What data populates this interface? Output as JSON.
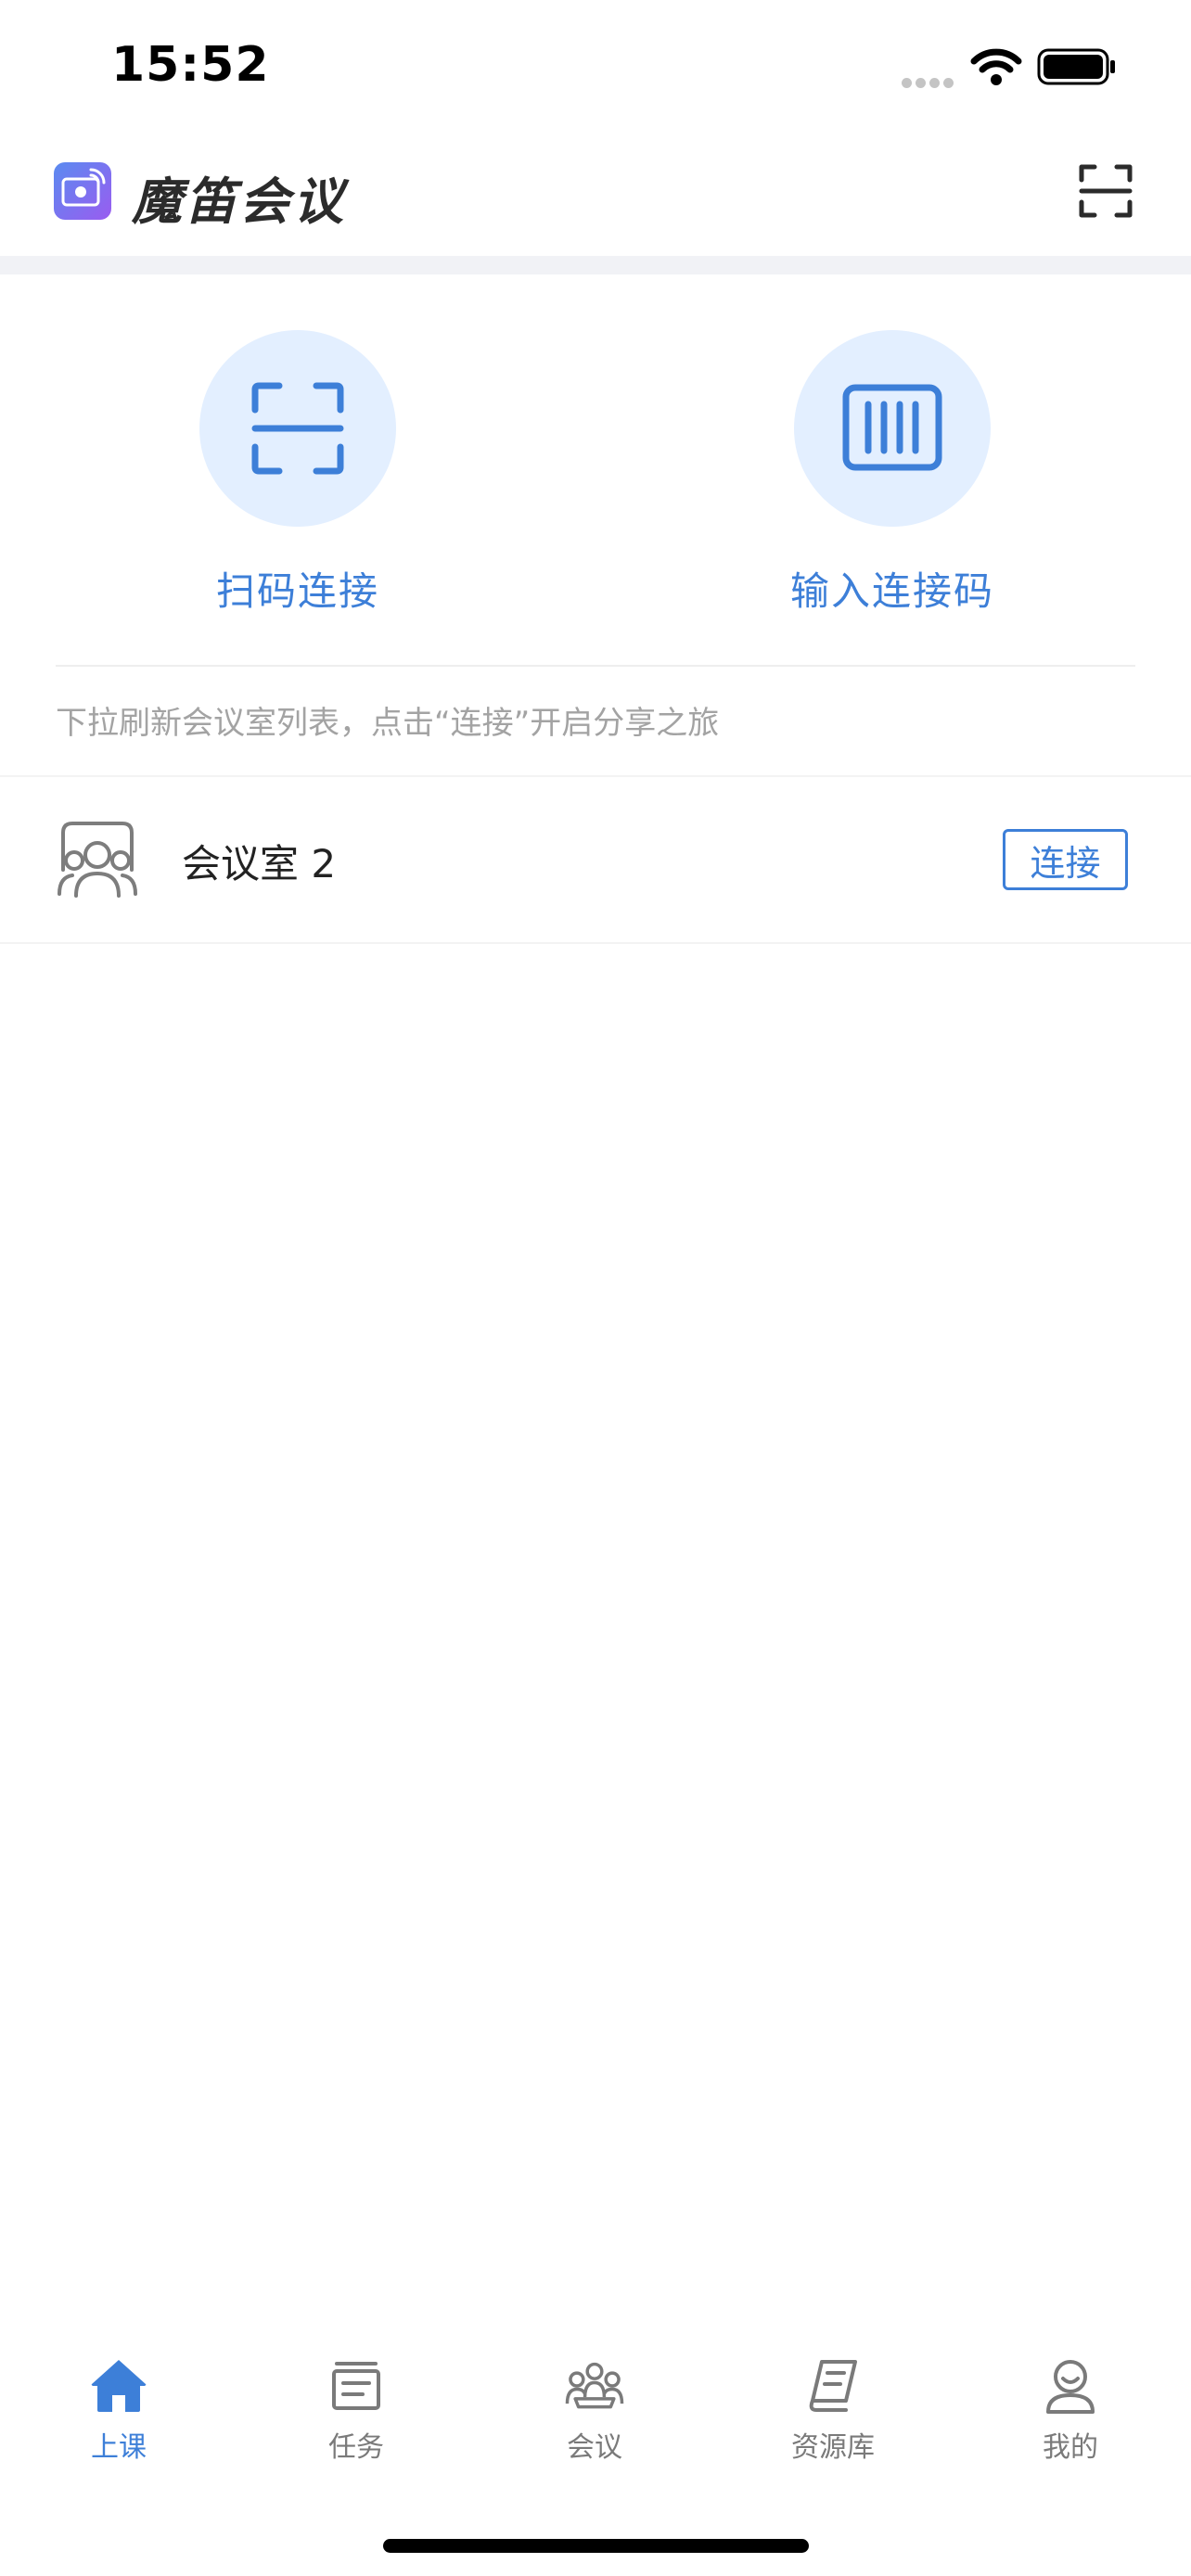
{
  "status_bar": {
    "time": "15:52",
    "icons": [
      "cellular-signal-icon",
      "wifi-icon",
      "battery-icon"
    ]
  },
  "header": {
    "app_name": "魔笛会议",
    "logo_icon": "app-logo-icon",
    "scan_icon": "scan-icon"
  },
  "actions": {
    "scan_label": "扫码连接",
    "code_label": "输入连接码"
  },
  "hint": "下拉刷新会议室列表，点击“连接”开启分享之旅",
  "rooms": [
    {
      "name": "会议室 2",
      "button_label": "连接"
    }
  ],
  "tabs": [
    {
      "label": "上课",
      "icon": "home-icon",
      "active": true
    },
    {
      "label": "任务",
      "icon": "task-icon",
      "active": false
    },
    {
      "label": "会议",
      "icon": "meeting-icon",
      "active": false
    },
    {
      "label": "资源库",
      "icon": "library-icon",
      "active": false
    },
    {
      "label": "我的",
      "icon": "profile-icon",
      "active": false
    }
  ],
  "colors": {
    "accent": "#3d7fd8",
    "accent_light": "#e3efff",
    "text_primary": "#222222",
    "text_muted": "#a3a3a3",
    "tab_inactive": "#7a7a7a"
  }
}
